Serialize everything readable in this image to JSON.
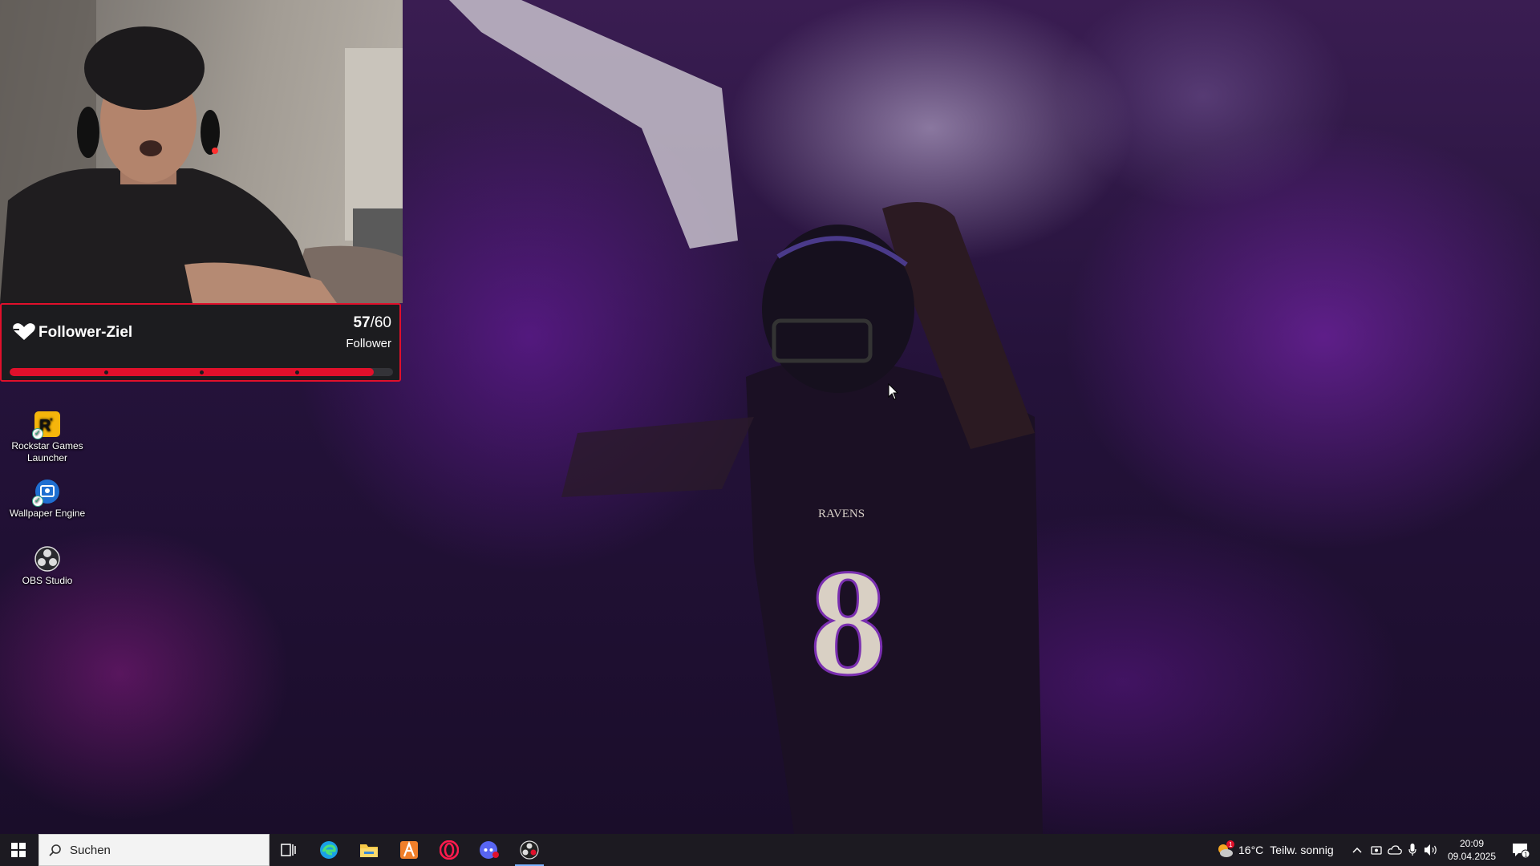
{
  "follower_goal": {
    "title": "Follower-Ziel",
    "current": "57",
    "total": "/60",
    "unit": "Follower",
    "progress": 0.95
  },
  "desktop_icons": [
    {
      "label": "Rockstar Games Launcher",
      "icon": "rockstar-icon"
    },
    {
      "label": "Wallpaper Engine",
      "icon": "wallpaper-engine-icon"
    },
    {
      "label": "OBS Studio",
      "icon": "obs-icon"
    }
  ],
  "wallpaper": {
    "jersey_team": "RAVENS",
    "jersey_number": "8"
  },
  "taskbar": {
    "search_placeholder": "Suchen",
    "apps": [
      {
        "name": "Aufgabenansicht",
        "icon": "task-view-icon"
      },
      {
        "name": "Microsoft Edge",
        "icon": "edge-icon"
      },
      {
        "name": "Datei-Explorer",
        "icon": "file-explorer-icon"
      },
      {
        "name": "App",
        "icon": "app-a-icon"
      },
      {
        "name": "Opera GX",
        "icon": "opera-icon"
      },
      {
        "name": "Discord",
        "icon": "discord-icon"
      },
      {
        "name": "OBS Studio",
        "icon": "obs-icon",
        "active": true
      }
    ],
    "weather": {
      "temp": "16°C",
      "desc": "Teilw. sonnig",
      "badge": "1"
    },
    "time": "20:09",
    "date": "09.04.2025",
    "notification_count": "1"
  },
  "colors": {
    "accent_red": "#e0102b",
    "taskbar": "#1c1a21",
    "ravens_purple": "#3a1d52"
  }
}
